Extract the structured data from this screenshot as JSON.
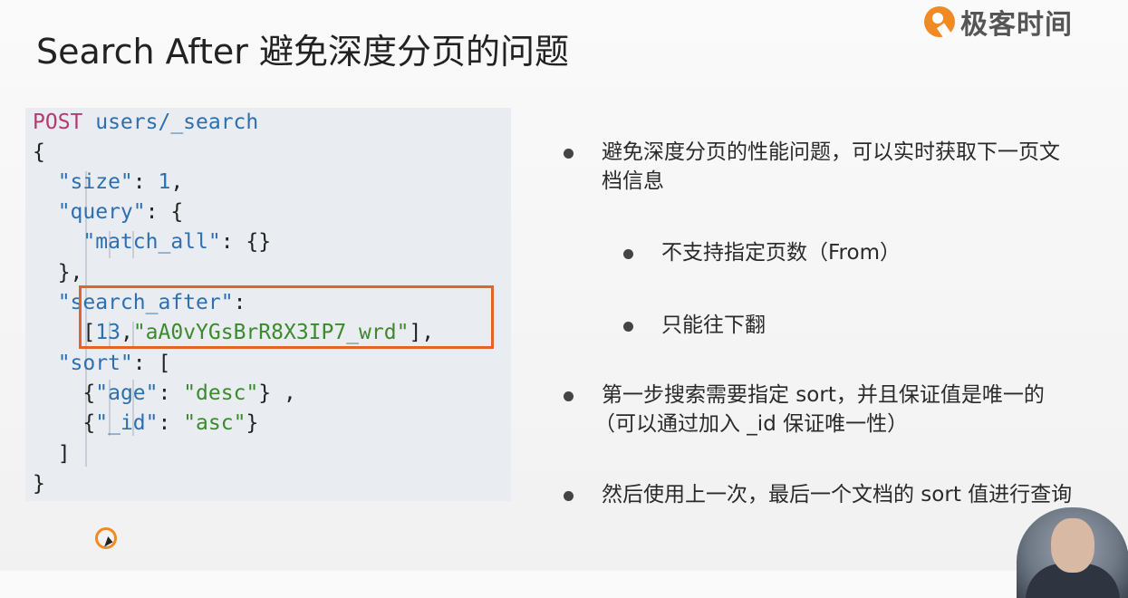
{
  "header": {
    "title": "Search After 避免深度分页的问题",
    "logo_text": "极客时间",
    "logo_color": "#f08a24"
  },
  "code": {
    "lines": [
      {
        "parts": [
          {
            "t": "POST",
            "c": "kw"
          },
          {
            "t": " users/_search",
            "c": "url"
          }
        ]
      },
      {
        "parts": [
          {
            "t": "{",
            "c": "punc"
          }
        ]
      },
      {
        "parts": [
          {
            "t": "  \"size\"",
            "c": "key"
          },
          {
            "t": ": ",
            "c": "punc"
          },
          {
            "t": "1",
            "c": "num"
          },
          {
            "t": ",",
            "c": "punc"
          }
        ]
      },
      {
        "parts": [
          {
            "t": "  \"query\"",
            "c": "key"
          },
          {
            "t": ": {",
            "c": "punc"
          }
        ]
      },
      {
        "parts": [
          {
            "t": "    \"match_all\"",
            "c": "key"
          },
          {
            "t": ": {}",
            "c": "punc"
          }
        ]
      },
      {
        "parts": [
          {
            "t": "  },",
            "c": "punc"
          }
        ]
      },
      {
        "parts": [
          {
            "t": "  \"search_after\"",
            "c": "key"
          },
          {
            "t": ":",
            "c": "punc"
          }
        ]
      },
      {
        "parts": [
          {
            "t": "    [",
            "c": "punc"
          },
          {
            "t": "13",
            "c": "num"
          },
          {
            "t": ",",
            "c": "punc"
          },
          {
            "t": "\"aA0vYGsBrR8X3IP7_wrd\"",
            "c": "str"
          },
          {
            "t": "],",
            "c": "punc"
          }
        ]
      },
      {
        "parts": [
          {
            "t": "  \"sort\"",
            "c": "key"
          },
          {
            "t": ": [",
            "c": "punc"
          }
        ]
      },
      {
        "parts": [
          {
            "t": "    {",
            "c": "punc"
          },
          {
            "t": "\"age\"",
            "c": "key"
          },
          {
            "t": ": ",
            "c": "punc"
          },
          {
            "t": "\"desc\"",
            "c": "str"
          },
          {
            "t": "} ,",
            "c": "punc"
          }
        ]
      },
      {
        "parts": [
          {
            "t": "    {",
            "c": "punc"
          },
          {
            "t": "\"_id\"",
            "c": "key"
          },
          {
            "t": ": ",
            "c": "punc"
          },
          {
            "t": "\"asc\"",
            "c": "str"
          },
          {
            "t": "}",
            "c": "punc"
          }
        ]
      },
      {
        "parts": [
          {
            "t": "  ]",
            "c": "punc"
          }
        ]
      },
      {
        "parts": [
          {
            "t": "}",
            "c": "punc"
          }
        ]
      }
    ],
    "highlight_color": "#e0642c"
  },
  "bullets": [
    {
      "level": 1,
      "lines": [
        "避免深度分页的性能问题，可以实时获取下一页文",
        "档信息"
      ]
    },
    {
      "level": 2,
      "lines": [
        "不支持指定页数（From）"
      ]
    },
    {
      "level": 2,
      "lines": [
        "只能往下翻"
      ]
    },
    {
      "level": 1,
      "lines": [
        "第一步搜索需要指定 sort，并且保证值是唯一的",
        "（可以通过加入 _id 保证唯一性）"
      ]
    },
    {
      "level": 1,
      "lines": [
        "然后使用上一次，最后一个文档的 sort 值进行查询"
      ]
    }
  ]
}
